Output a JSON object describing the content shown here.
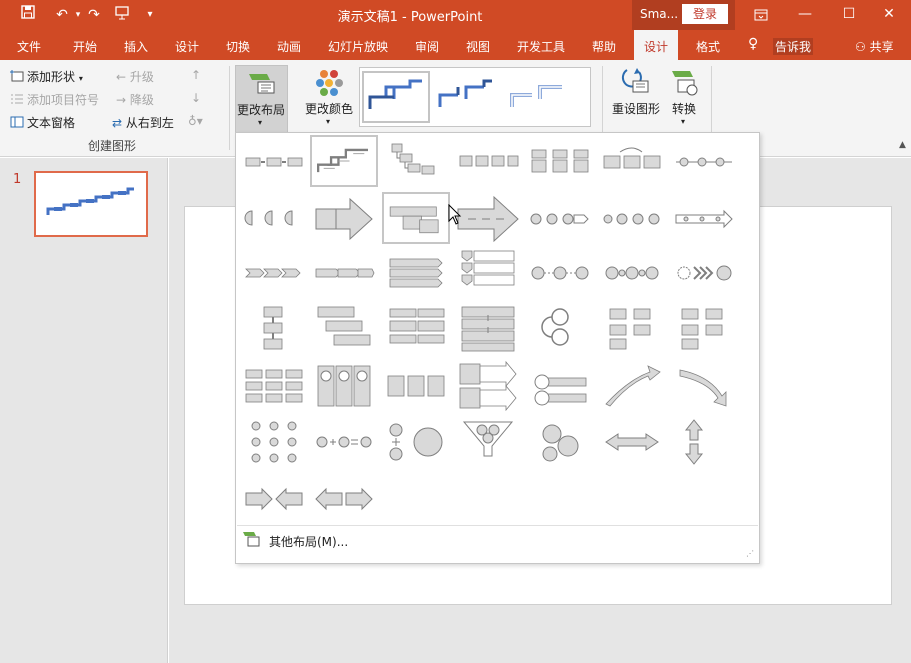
{
  "window": {
    "title": "演示文稿1  -  PowerPoint",
    "account": "Sma...",
    "login": "登录",
    "qat_dropdown": "▾",
    "controls": [
      "ribbon-display-icon",
      "minimize-icon",
      "maximize-icon",
      "close-icon"
    ]
  },
  "tabs": [
    {
      "label": "文件"
    },
    {
      "label": "开始"
    },
    {
      "label": "插入"
    },
    {
      "label": "设计"
    },
    {
      "label": "切换"
    },
    {
      "label": "动画"
    },
    {
      "label": "幻灯片放映"
    },
    {
      "label": "审阅"
    },
    {
      "label": "视图"
    },
    {
      "label": "开发工具"
    },
    {
      "label": "帮助"
    },
    {
      "label": "设计"
    },
    {
      "label": "格式"
    }
  ],
  "tell_me": "告诉我",
  "share": "共享",
  "ribbon": {
    "create_graphic": {
      "add_shape": "添加形状",
      "add_bullet": "添加项目符号",
      "text_pane": "文本窗格",
      "promote": "升级",
      "demote": "降级",
      "right_to_left": "从右到左",
      "group_label": "创建图形"
    },
    "change_layout": "更改布局",
    "change_colors": "更改颜色",
    "reset_graphic": "重设图形",
    "convert": "转换",
    "colors": {
      "orange": "#e8833a",
      "blue": "#4a8fd0",
      "green": "#6aab47",
      "red": "#d0433a",
      "yellow": "#f2b134",
      "gray": "#9a9a9a"
    }
  },
  "slides": {
    "number": "1"
  },
  "gallery": {
    "more_layouts": "其他布局(M)...",
    "accent": "#4472c4",
    "shape_fill": "#d9d9d9",
    "shape_stroke": "#7f7f7f"
  }
}
